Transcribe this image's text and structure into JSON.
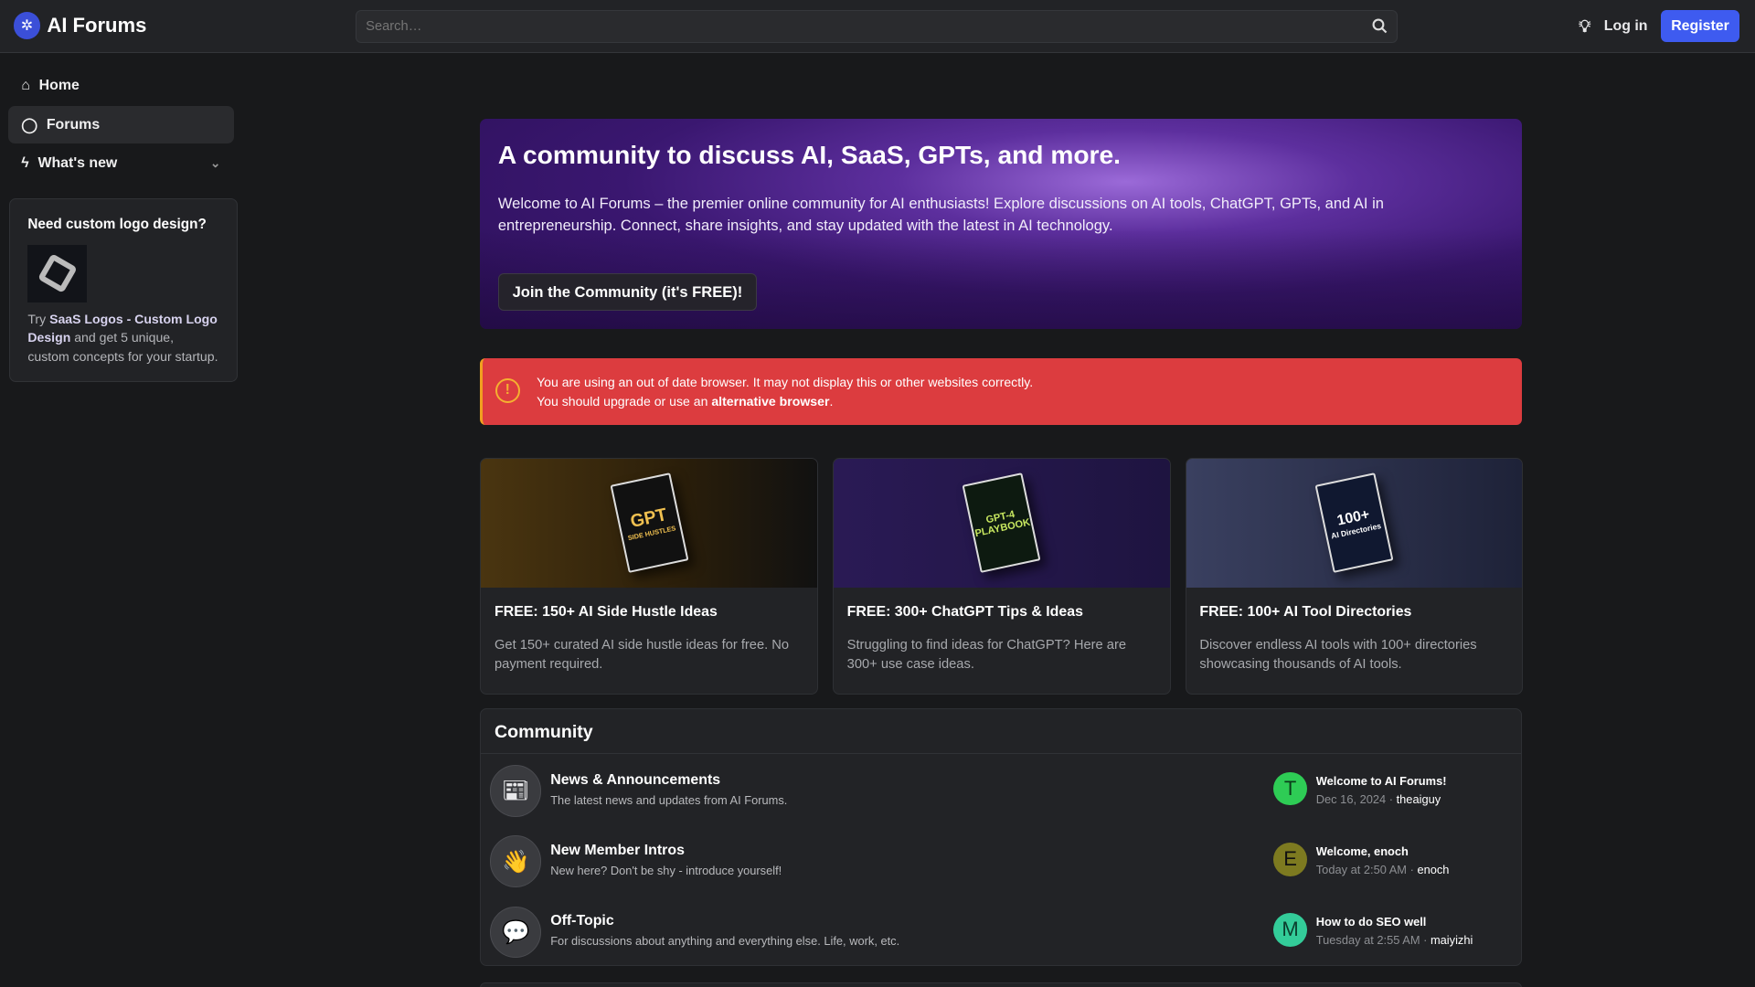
{
  "header": {
    "site_name": "AI Forums",
    "search_placeholder": "Search…",
    "login": "Log in",
    "register": "Register"
  },
  "sidebar": {
    "items": [
      {
        "label": "Home",
        "icon": "home-icon"
      },
      {
        "label": "Forums",
        "icon": "chat-bubble-icon",
        "active": true
      },
      {
        "label": "What's new",
        "icon": "bolt-icon"
      }
    ],
    "promo": {
      "title": "Need custom logo design?",
      "text_pre": "Try ",
      "link": "SaaS Logos - Custom Logo Design",
      "text_post": " and get 5 unique, custom concepts for your startup."
    }
  },
  "hero": {
    "title": "A community to discuss AI, SaaS, GPTs, and more.",
    "body": "Welcome to AI Forums – the premier online community for AI enthusiasts! Explore discussions on AI tools, ChatGPT, GPTs, and AI in entrepreneurship. Connect, share insights, and stay updated with the latest in AI technology.",
    "cta": "Join the Community (it's FREE)!"
  },
  "alert": {
    "line1": "You are using an out of date browser. It may not display this or other websites correctly.",
    "line2_pre": "You should upgrade or use an ",
    "line2_link": "alternative browser",
    "line2_post": "."
  },
  "cards": [
    {
      "title": "FREE: 150+ AI Side Hustle Ideas",
      "desc": "Get 150+ curated AI side hustle ideas for free. No payment required.",
      "book_a": "GPT",
      "book_b": "SIDE HUSTLES"
    },
    {
      "title": "FREE: 300+ ChatGPT Tips & Ideas",
      "desc": "Struggling to find ideas for ChatGPT? Here are 300+ use case ideas.",
      "book_a": "GPT-4",
      "book_b": "PLAYBOOK"
    },
    {
      "title": "FREE: 100+ AI Tool Directories",
      "desc": "Discover endless AI tools with 100+ directories showcasing thousands of AI tools.",
      "book_a": "100+",
      "book_b": "AI Directories"
    }
  ],
  "community": {
    "title": "Community",
    "forums": [
      {
        "title": "News & Announcements",
        "desc": "The latest news and updates from AI Forums.",
        "icon": "newspaper-icon",
        "latest": "Welcome to AI Forums!",
        "date": "Dec 16, 2024",
        "user": "theaiguy",
        "avatar": "T",
        "avatar_color": "#2ecc55"
      },
      {
        "title": "New Member Intros",
        "desc": "New here? Don't be shy - introduce yourself!",
        "icon": "waving-hand-icon",
        "latest": "Welcome, enoch",
        "date": "Today at 2:50 AM",
        "user": "enoch",
        "avatar": "E",
        "avatar_color": "#7d7a20"
      },
      {
        "title": "Off-Topic",
        "desc": "For discussions about anything and everything else. Life, work, etc.",
        "icon": "speech-bubble-icon",
        "latest": "How to do SEO well",
        "date": "Tuesday at 2:55 AM",
        "user": "maiyizhi",
        "avatar": "M",
        "avatar_color": "#33cc99"
      }
    ]
  }
}
